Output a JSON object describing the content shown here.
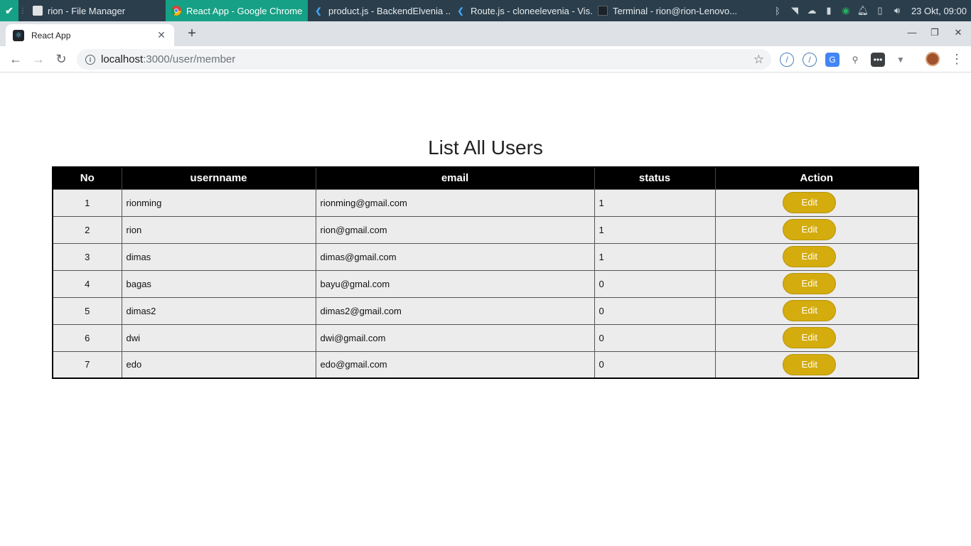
{
  "taskbar": {
    "tasks": [
      {
        "label": "rion - File Manager",
        "icon": "folder-icon"
      },
      {
        "label": "React App - Google Chrome",
        "icon": "chrome-icon"
      },
      {
        "label": "product.js - BackendElvenia ...",
        "icon": "vscode-icon"
      },
      {
        "label": "Route.js - cloneelevenia - Vis...",
        "icon": "vscode-icon"
      },
      {
        "label": "Terminal - rion@rion-Lenovo...",
        "icon": "terminal-icon"
      }
    ],
    "clock": "23 Okt, 09:00",
    "accent": "#16a085"
  },
  "browser": {
    "tab_title": "React App",
    "url_host": "localhost",
    "url_rest": ":3000/user/member"
  },
  "page": {
    "title": "List All Users",
    "columns": [
      "No",
      "usernname",
      "email",
      "status",
      "Action"
    ],
    "edit_label": "Edit",
    "rows": [
      {
        "no": "1",
        "username": "rionming",
        "email": "rionming@gmail.com",
        "status": "1"
      },
      {
        "no": "2",
        "username": "rion",
        "email": "rion@gmail.com",
        "status": "1"
      },
      {
        "no": "3",
        "username": "dimas",
        "email": "dimas@gmail.com",
        "status": "1"
      },
      {
        "no": "4",
        "username": "bagas",
        "email": "bayu@gmal.com",
        "status": "0"
      },
      {
        "no": "5",
        "username": "dimas2",
        "email": "dimas2@gmail.com",
        "status": "0"
      },
      {
        "no": "6",
        "username": "dwi",
        "email": "dwi@gmail.com",
        "status": "0"
      },
      {
        "no": "7",
        "username": "edo",
        "email": "edo@gmail.com",
        "status": "0"
      }
    ],
    "button_color": "#d4ac0d"
  }
}
